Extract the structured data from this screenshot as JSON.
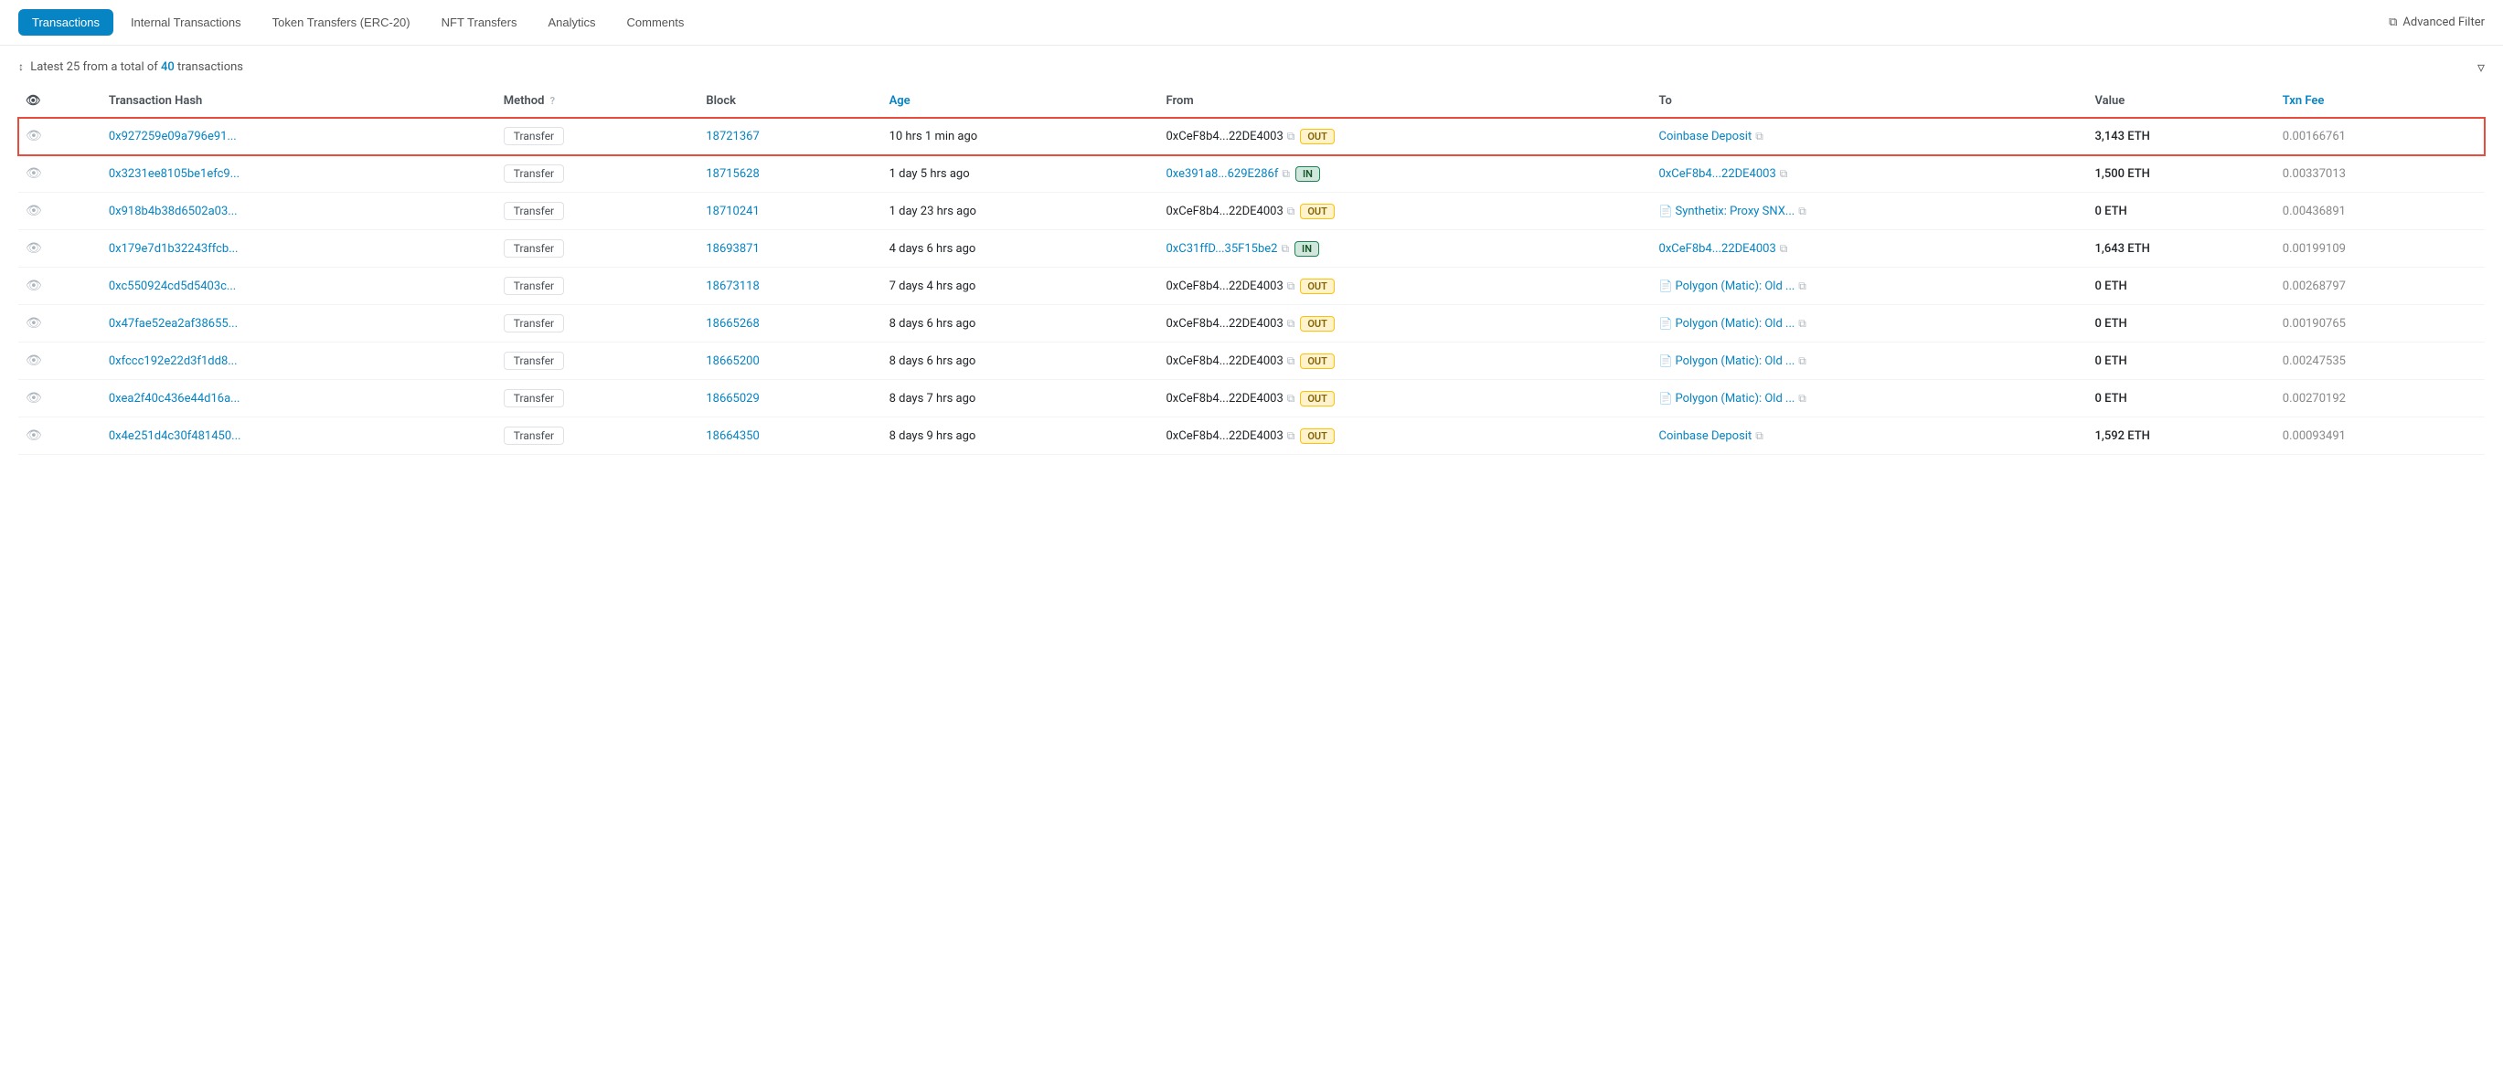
{
  "nav": {
    "tabs": [
      {
        "id": "transactions",
        "label": "Transactions",
        "active": true
      },
      {
        "id": "internal-transactions",
        "label": "Internal Transactions",
        "active": false
      },
      {
        "id": "token-transfers",
        "label": "Token Transfers (ERC-20)",
        "active": false
      },
      {
        "id": "nft-transfers",
        "label": "NFT Transfers",
        "active": false
      },
      {
        "id": "analytics",
        "label": "Analytics",
        "active": false
      },
      {
        "id": "comments",
        "label": "Comments",
        "active": false
      }
    ],
    "advanced_filter_label": "Advanced Filter"
  },
  "summary": {
    "text_prefix": "Latest 25 from a total of",
    "count": "40",
    "text_suffix": "transactions"
  },
  "table": {
    "columns": [
      {
        "id": "eye",
        "label": ""
      },
      {
        "id": "tx_hash",
        "label": "Transaction Hash"
      },
      {
        "id": "method",
        "label": "Method"
      },
      {
        "id": "block",
        "label": "Block"
      },
      {
        "id": "age",
        "label": "Age"
      },
      {
        "id": "from",
        "label": "From"
      },
      {
        "id": "to",
        "label": "To"
      },
      {
        "id": "value",
        "label": "Value"
      },
      {
        "id": "txn_fee",
        "label": "Txn Fee"
      }
    ],
    "rows": [
      {
        "id": 1,
        "highlighted": true,
        "tx_hash": "0x927259e09a796e91...",
        "method": "Transfer",
        "block": "18721367",
        "age": "10 hrs 1 min ago",
        "from": "0xCeF8b4...22DE4003",
        "direction": "OUT",
        "to": "Coinbase Deposit",
        "to_is_contract": false,
        "value": "3,143 ETH",
        "txn_fee": "0.00166761"
      },
      {
        "id": 2,
        "highlighted": false,
        "tx_hash": "0x3231ee8105be1efc9...",
        "method": "Transfer",
        "block": "18715628",
        "age": "1 day 5 hrs ago",
        "from": "0xe391a8...629E286f",
        "direction": "IN",
        "to": "0xCeF8b4...22DE4003",
        "to_is_contract": false,
        "value": "1,500 ETH",
        "txn_fee": "0.00337013"
      },
      {
        "id": 3,
        "highlighted": false,
        "tx_hash": "0x918b4b38d6502a03...",
        "method": "Transfer",
        "block": "18710241",
        "age": "1 day 23 hrs ago",
        "from": "0xCeF8b4...22DE4003",
        "direction": "OUT",
        "to": "Synthetix: Proxy SNX...",
        "to_is_contract": true,
        "value": "0 ETH",
        "txn_fee": "0.00436891"
      },
      {
        "id": 4,
        "highlighted": false,
        "tx_hash": "0x179e7d1b32243ffcb...",
        "method": "Transfer",
        "block": "18693871",
        "age": "4 days 6 hrs ago",
        "from": "0xC31ffD...35F15be2",
        "direction": "IN",
        "to": "0xCeF8b4...22DE4003",
        "to_is_contract": false,
        "value": "1,643 ETH",
        "txn_fee": "0.00199109"
      },
      {
        "id": 5,
        "highlighted": false,
        "tx_hash": "0xc550924cd5d5403c...",
        "method": "Transfer",
        "block": "18673118",
        "age": "7 days 4 hrs ago",
        "from": "0xCeF8b4...22DE4003",
        "direction": "OUT",
        "to": "Polygon (Matic): Old ...",
        "to_is_contract": true,
        "value": "0 ETH",
        "txn_fee": "0.00268797"
      },
      {
        "id": 6,
        "highlighted": false,
        "tx_hash": "0x47fae52ea2af38655...",
        "method": "Transfer",
        "block": "18665268",
        "age": "8 days 6 hrs ago",
        "from": "0xCeF8b4...22DE4003",
        "direction": "OUT",
        "to": "Polygon (Matic): Old ...",
        "to_is_contract": true,
        "value": "0 ETH",
        "txn_fee": "0.00190765"
      },
      {
        "id": 7,
        "highlighted": false,
        "tx_hash": "0xfccc192e22d3f1dd8...",
        "method": "Transfer",
        "block": "18665200",
        "age": "8 days 6 hrs ago",
        "from": "0xCeF8b4...22DE4003",
        "direction": "OUT",
        "to": "Polygon (Matic): Old ...",
        "to_is_contract": true,
        "value": "0 ETH",
        "txn_fee": "0.00247535"
      },
      {
        "id": 8,
        "highlighted": false,
        "tx_hash": "0xea2f40c436e44d16a...",
        "method": "Transfer",
        "block": "18665029",
        "age": "8 days 7 hrs ago",
        "from": "0xCeF8b4...22DE4003",
        "direction": "OUT",
        "to": "Polygon (Matic): Old ...",
        "to_is_contract": true,
        "value": "0 ETH",
        "txn_fee": "0.00270192"
      },
      {
        "id": 9,
        "highlighted": false,
        "tx_hash": "0x4e251d4c30f481450...",
        "method": "Transfer",
        "block": "18664350",
        "age": "8 days 9 hrs ago",
        "from": "0xCeF8b4...22DE4003",
        "direction": "OUT",
        "to": "Coinbase Deposit",
        "to_is_contract": false,
        "value": "1,592 ETH",
        "txn_fee": "0.00093491"
      }
    ]
  }
}
